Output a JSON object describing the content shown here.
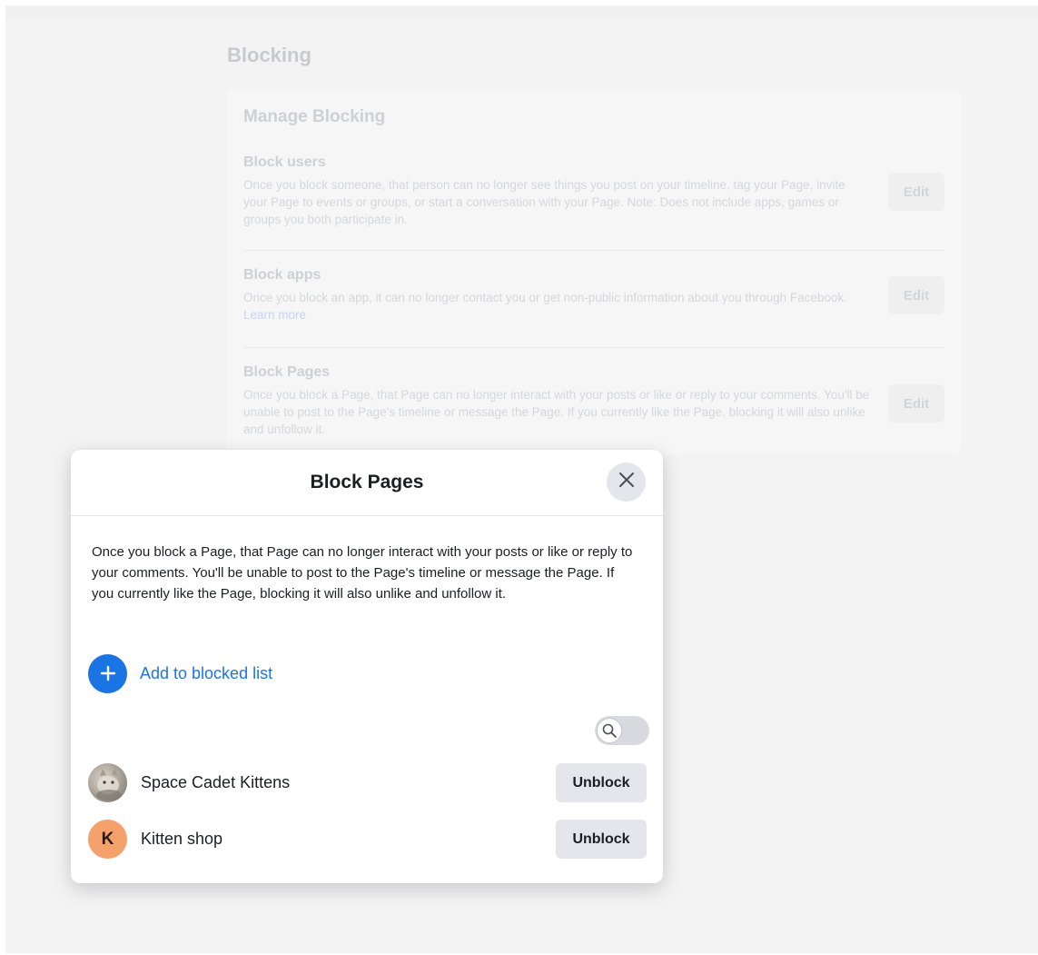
{
  "background": {
    "heading": "Blocking",
    "card_title": "Manage Blocking",
    "sections": [
      {
        "title": "Block users",
        "description": "Once you block someone, that person can no longer see things you post on your timeline, tag your Page, invite your Page to events or groups, or start a conversation with your Page. Note: Does not include apps, games or groups you both participate in.",
        "edit_label": "Edit"
      },
      {
        "title": "Block apps",
        "description": "Once you block an app, it can no longer contact you or get non-public information about you through Facebook.",
        "link": "Learn more",
        "edit_label": "Edit"
      },
      {
        "title": "Block Pages",
        "description": "Once you block a Page, that Page can no longer interact with your posts or like or reply to your comments. You'll be unable to post to the Page's timeline or message the Page. If you currently like the Page, blocking it will also unlike and unfollow it.",
        "edit_label": "Edit"
      }
    ]
  },
  "modal": {
    "title": "Block Pages",
    "description": "Once you block a Page, that Page can no longer interact with your posts or like or reply to your comments. You'll be unable to post to the Page's timeline or message the Page. If you currently like the Page, blocking it will also unlike and unfollow it.",
    "add_label": "Add to blocked list",
    "blocked_pages": [
      {
        "name": "Space Cadet Kittens",
        "avatar": "photo",
        "button": "Unblock"
      },
      {
        "name": "Kitten shop",
        "avatar_letter": "K",
        "button": "Unblock"
      }
    ]
  },
  "colors": {
    "accent": "#1b74e4",
    "avatar_k": "#f5a16c"
  },
  "icons": {
    "close": "close-icon",
    "add": "plus-icon",
    "search": "search-icon"
  }
}
